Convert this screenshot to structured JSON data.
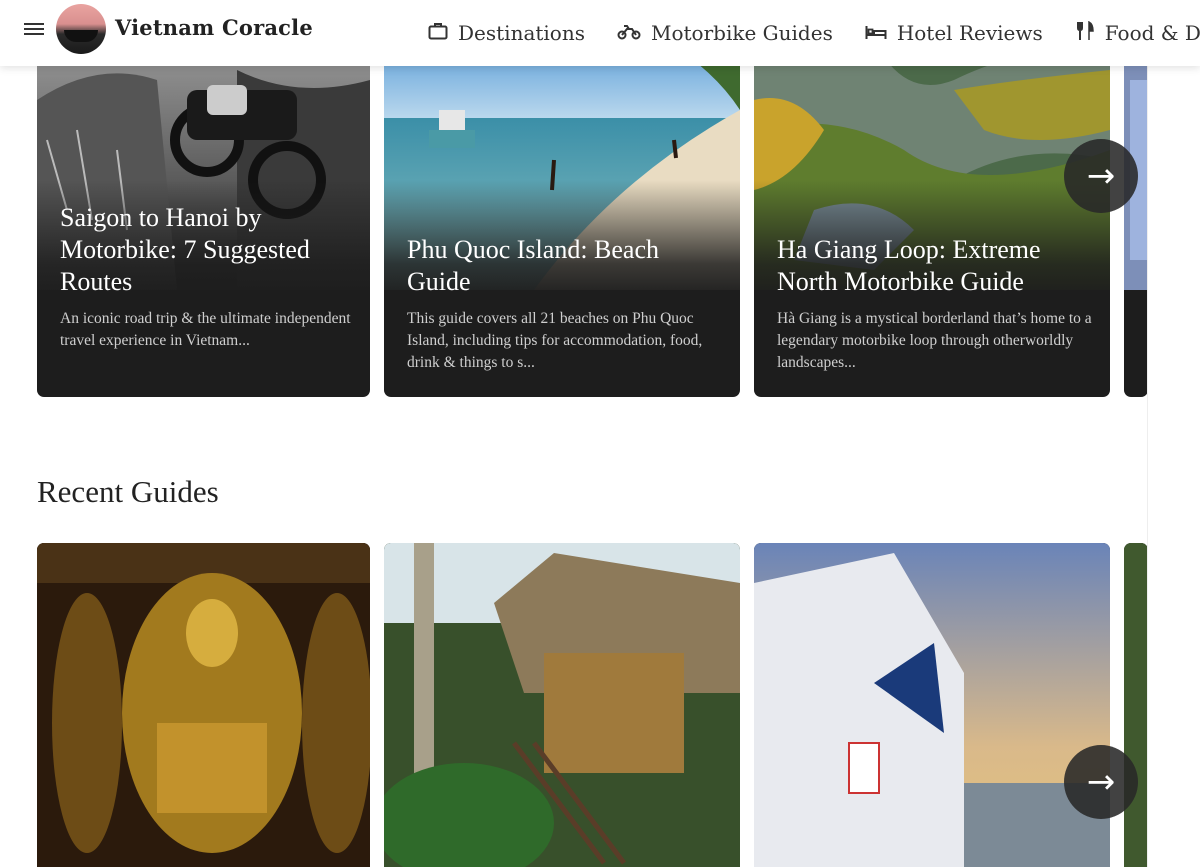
{
  "header": {
    "brand": "Vietnam Coracle",
    "nav": [
      {
        "label": "Destinations",
        "icon": "suitcase-icon"
      },
      {
        "label": "Motorbike Guides",
        "icon": "motorbike-icon"
      },
      {
        "label": "Hotel Reviews",
        "icon": "bed-icon"
      },
      {
        "label": "Food & Drin",
        "icon": "fork-knife-icon"
      }
    ]
  },
  "featured": {
    "cards": [
      {
        "title": "Saigon to Hanoi by Motorbike: 7 Suggested Routes",
        "excerpt": "An iconic road trip & the ultimate independent travel experience in Vietnam..."
      },
      {
        "title": "Phu Quoc Island: Beach Guide",
        "excerpt": "This guide covers all 21 beaches on Phu Quoc Island, including tips for accommodation, food, drink & things to s..."
      },
      {
        "title": "Ha Giang Loop: Extreme North Motorbike Guide",
        "excerpt": "Hà Giang is a mystical borderland that’s home to a legendary motorbike loop through otherworldly landscapes..."
      }
    ],
    "next_label": "→"
  },
  "recent": {
    "title": "Recent Guides",
    "next_label": "→"
  }
}
